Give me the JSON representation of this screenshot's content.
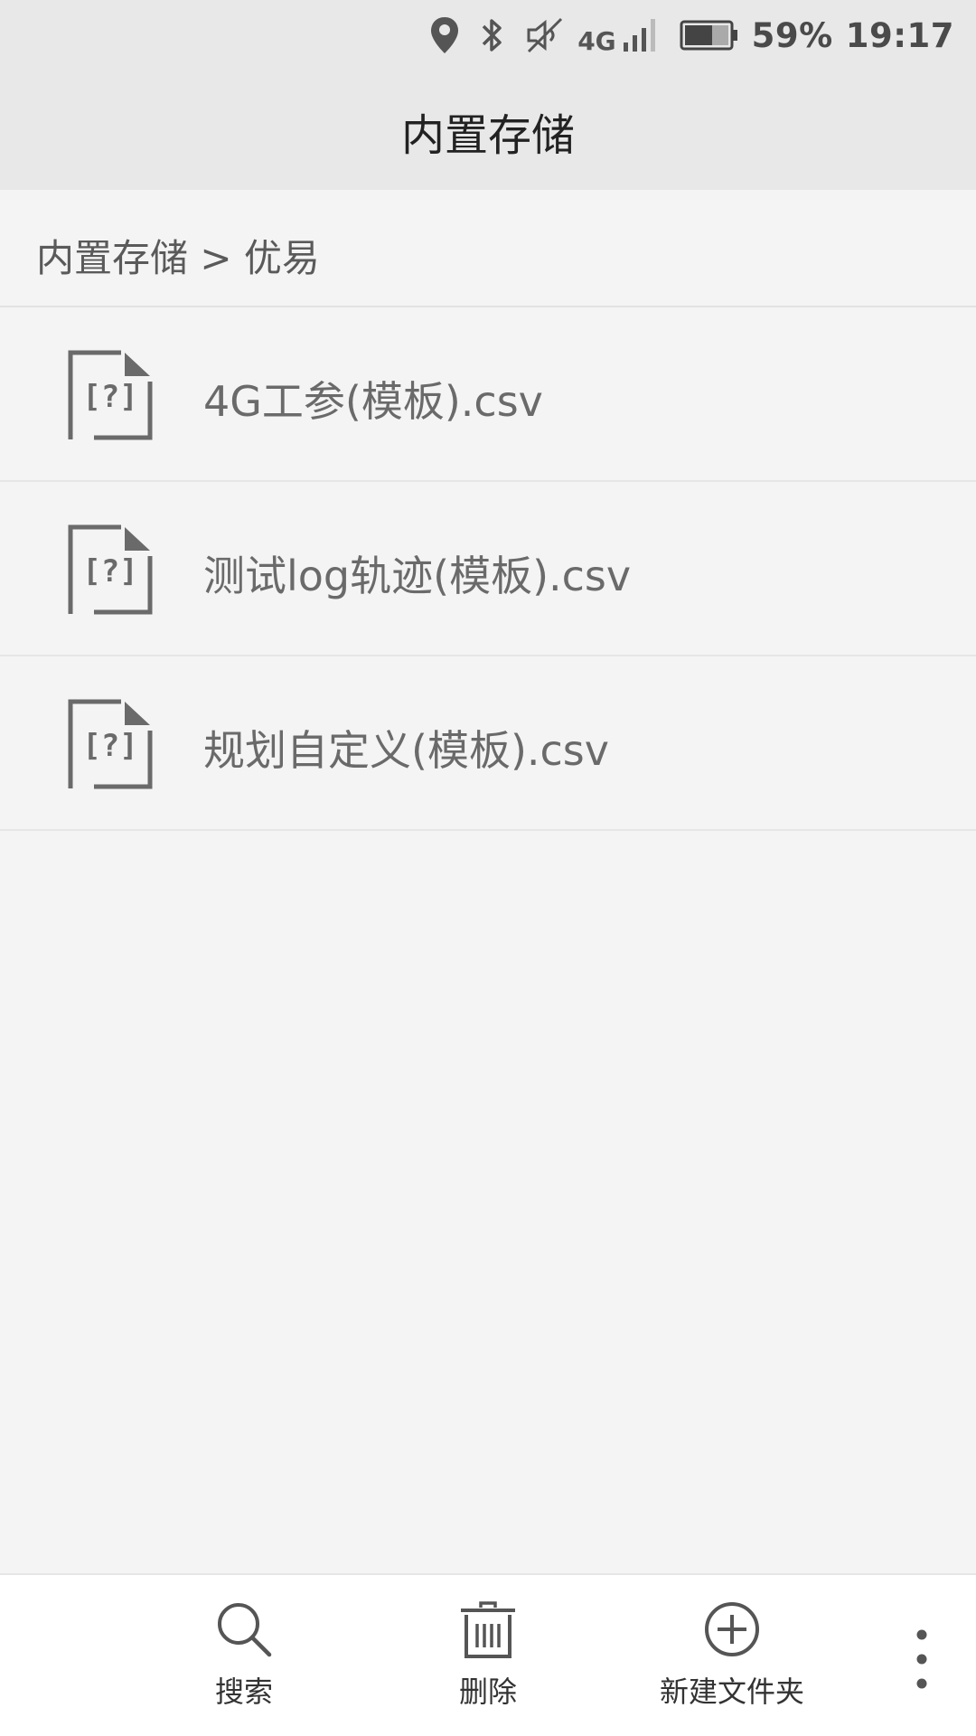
{
  "status_bar": {
    "battery_percent": "59%",
    "time": "19:17",
    "network_label": "4G",
    "icons": [
      "location-icon",
      "bluetooth-icon",
      "muted-icon",
      "signal-icon",
      "battery-icon"
    ]
  },
  "header": {
    "title": "内置存储"
  },
  "breadcrumb": {
    "path": "内置存储 > 优易"
  },
  "files": [
    {
      "name": "4G工参(模板).csv",
      "icon": "unknown-file-icon"
    },
    {
      "name": "测试log轨迹(模板).csv",
      "icon": "unknown-file-icon"
    },
    {
      "name": "规划自定义(模板).csv",
      "icon": "unknown-file-icon"
    }
  ],
  "toolbar": {
    "search_label": "搜索",
    "delete_label": "删除",
    "new_folder_label": "新建文件夹"
  },
  "colors": {
    "status_bg": "#e8e8e8",
    "content_bg": "#f4f4f4",
    "toolbar_bg": "#ffffff",
    "icon_gray": "#6a6a6a"
  }
}
